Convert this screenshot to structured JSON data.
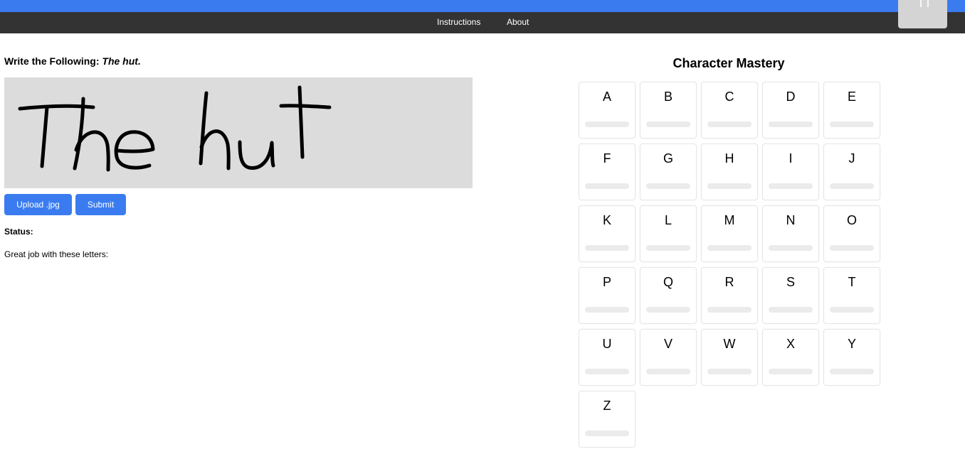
{
  "nav": {
    "links": [
      "Instructions",
      "About"
    ]
  },
  "prompt": {
    "label": "Write the Following:",
    "text": "The hut."
  },
  "canvas": {
    "handwriting": "The hut"
  },
  "buttons": {
    "upload_label": "Upload .jpg",
    "submit_label": "Submit"
  },
  "status": {
    "label": "Status:",
    "value": ""
  },
  "feedback": {
    "text": "Great job with these letters:"
  },
  "mastery": {
    "title": "Character Mastery",
    "letters": [
      {
        "letter": "A",
        "progress": 0
      },
      {
        "letter": "B",
        "progress": 0
      },
      {
        "letter": "C",
        "progress": 0
      },
      {
        "letter": "D",
        "progress": 0
      },
      {
        "letter": "E",
        "progress": 0
      },
      {
        "letter": "F",
        "progress": 0
      },
      {
        "letter": "G",
        "progress": 0
      },
      {
        "letter": "H",
        "progress": 0
      },
      {
        "letter": "I",
        "progress": 0
      },
      {
        "letter": "J",
        "progress": 0
      },
      {
        "letter": "K",
        "progress": 0
      },
      {
        "letter": "L",
        "progress": 0
      },
      {
        "letter": "M",
        "progress": 0
      },
      {
        "letter": "N",
        "progress": 0
      },
      {
        "letter": "O",
        "progress": 0
      },
      {
        "letter": "P",
        "progress": 0
      },
      {
        "letter": "Q",
        "progress": 0
      },
      {
        "letter": "R",
        "progress": 0
      },
      {
        "letter": "S",
        "progress": 0
      },
      {
        "letter": "T",
        "progress": 0
      },
      {
        "letter": "U",
        "progress": 0
      },
      {
        "letter": "V",
        "progress": 0
      },
      {
        "letter": "W",
        "progress": 0
      },
      {
        "letter": "X",
        "progress": 0
      },
      {
        "letter": "Y",
        "progress": 0
      },
      {
        "letter": "Z",
        "progress": 0
      }
    ]
  },
  "colors": {
    "accent": "#3a7cf0",
    "navbar": "#333333",
    "canvas_bg": "#dcdcdc",
    "ink": "#000000"
  }
}
